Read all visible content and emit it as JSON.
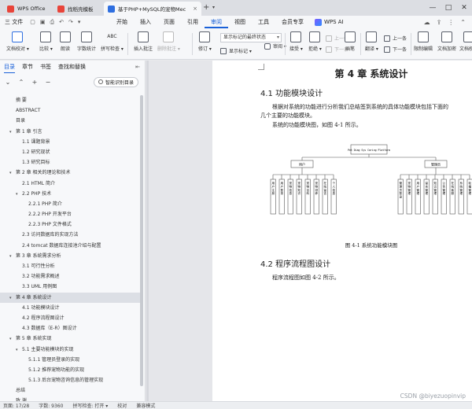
{
  "tabs": [
    {
      "label": "WPS Office",
      "color": "#e8443a"
    },
    {
      "label": "找稻壳模板",
      "color": "#e8443a"
    },
    {
      "label": "基于PHP+MySQL的宠物Mec",
      "color": "#2f6fe0"
    }
  ],
  "menubar": {
    "file": "三 文件",
    "items": [
      "开始",
      "插入",
      "页面",
      "引用",
      "审阅",
      "视图",
      "工具",
      "会员专享"
    ],
    "active": "审阅",
    "ai": "WPS AI"
  },
  "ribbon": {
    "buttons": [
      {
        "label": "文档校对 ▾"
      },
      {
        "label": "比较 ▾"
      },
      {
        "label": "朗读"
      },
      {
        "label": "字数统计"
      },
      {
        "label": "拼写检查 ▾"
      },
      {
        "label": "插入批注"
      },
      {
        "label": "删除批注 ▾"
      },
      {
        "label": "修订 ▾"
      },
      {
        "label": "审阅 ▾"
      },
      {
        "label": "接受 ▾"
      },
      {
        "label": "拒绝 ▾"
      },
      {
        "label": "画笔"
      },
      {
        "label": "翻译 ▾"
      },
      {
        "label": "限制编辑"
      },
      {
        "label": "文档加密"
      },
      {
        "label": "文档权限"
      }
    ],
    "smalls": {
      "show_markup": "显示标记 ▾",
      "prev": "上一条",
      "next": "下一条",
      "compare_prev": "上一条",
      "compare_next": "下一条",
      "abc": "ABC",
      "pen": "画笔"
    },
    "markup_select": "显示标记的最终状态"
  },
  "nav": {
    "tabs": [
      "目录",
      "章节",
      "书签",
      "查找和替换"
    ],
    "active_tab": "目录",
    "pin": "⇤",
    "smart_toc": "智能识别目录",
    "toc": [
      {
        "label": "摘  要",
        "level": 0
      },
      {
        "label": "ABSTRACT",
        "level": 0
      },
      {
        "label": "目录",
        "level": 0
      },
      {
        "label": "第 1 章  引言",
        "level": 0,
        "exp": true
      },
      {
        "label": "1.1  课题背景",
        "level": 1
      },
      {
        "label": "1.2 研究现状",
        "level": 1
      },
      {
        "label": "1.3 研究目标",
        "level": 1
      },
      {
        "label": "第 2 章  相关的理论和技术",
        "level": 0,
        "exp": true
      },
      {
        "label": "2.1 HTML  简介",
        "level": 1
      },
      {
        "label": "2.2 PHP  技术",
        "level": 1,
        "exp": true
      },
      {
        "label": "2.2.1 PHP 简介",
        "level": 2
      },
      {
        "label": "2.2.2 PHP 开发平台",
        "level": 2
      },
      {
        "label": "2.2.3 PHP 文件格式",
        "level": 2
      },
      {
        "label": "2.3  访问数据库的实现方法",
        "level": 1
      },
      {
        "label": "2.4 tomcat  数据库连接池介绍与配置",
        "level": 1
      },
      {
        "label": "第 3 章  系统需求分析",
        "level": 0,
        "exp": true
      },
      {
        "label": "3.1  可行性分析",
        "level": 1
      },
      {
        "label": "3.2  功能需求概述",
        "level": 1
      },
      {
        "label": "3.3 UML 用例图",
        "level": 1
      },
      {
        "label": "第 4 章  系统设计",
        "level": 0,
        "exp": true,
        "sel": true
      },
      {
        "label": "4.1 功能模块设计",
        "level": 1
      },
      {
        "label": "4.2  程序流程图设计",
        "level": 1
      },
      {
        "label": "4.3  数据库（E-R）图设计",
        "level": 1
      },
      {
        "label": "第 5 章  系统实现",
        "level": 0,
        "exp": true
      },
      {
        "label": "5.1  主要功能模块的实现",
        "level": 1,
        "exp": true
      },
      {
        "label": "5.1.1  管理员登录的实现",
        "level": 2
      },
      {
        "label": "5.1.2  推荐宠物功能的实现",
        "level": 2
      },
      {
        "label": "5.1.3 后台宠物咨询信息的管理实现",
        "level": 2
      },
      {
        "label": "总结",
        "level": 0
      },
      {
        "label": "致  谢",
        "level": 0
      }
    ]
  },
  "document": {
    "chapter_title": "第 4 章  系统设计",
    "section1_title": "4.1 功能模块设计",
    "para1_line1": "根据对系统的功能进行分析我们总结签到系统的具体功能模块包括下面的",
    "para1_line2": "几个主要的功能模块。",
    "para2": "系统的功能模块图，如图 4-1 所示。",
    "diagram": {
      "root": "Pet Diag Sys Caring Platform",
      "left_node": "用户",
      "right_node": "管理员",
      "left_leaves": [
        "用户注册",
        "用户登录",
        "宠物信息",
        "宠物知识",
        "宠物百科",
        "宠物领养",
        "在线留言",
        "个人信息"
      ],
      "right_leaves": [
        "管理员登录",
        "宠物管理",
        "用户管理",
        "留言管理",
        "知识管理",
        "公告管理",
        "在线客服",
        "系统管理",
        "轮播管理"
      ]
    },
    "figure_caption": "图 4-1  系统功能模块图",
    "section2_title": "4.2  程序流程图设计",
    "para3": "程序流程图如图 4-2 所示。"
  },
  "status": {
    "page": "页面: 17/28",
    "words": "字数: 9360",
    "spell": "拼写检查: 打开 ▾",
    "proof": "校对",
    "compat": "兼容模式"
  },
  "watermark": "CSDN @biyezuopinvip"
}
